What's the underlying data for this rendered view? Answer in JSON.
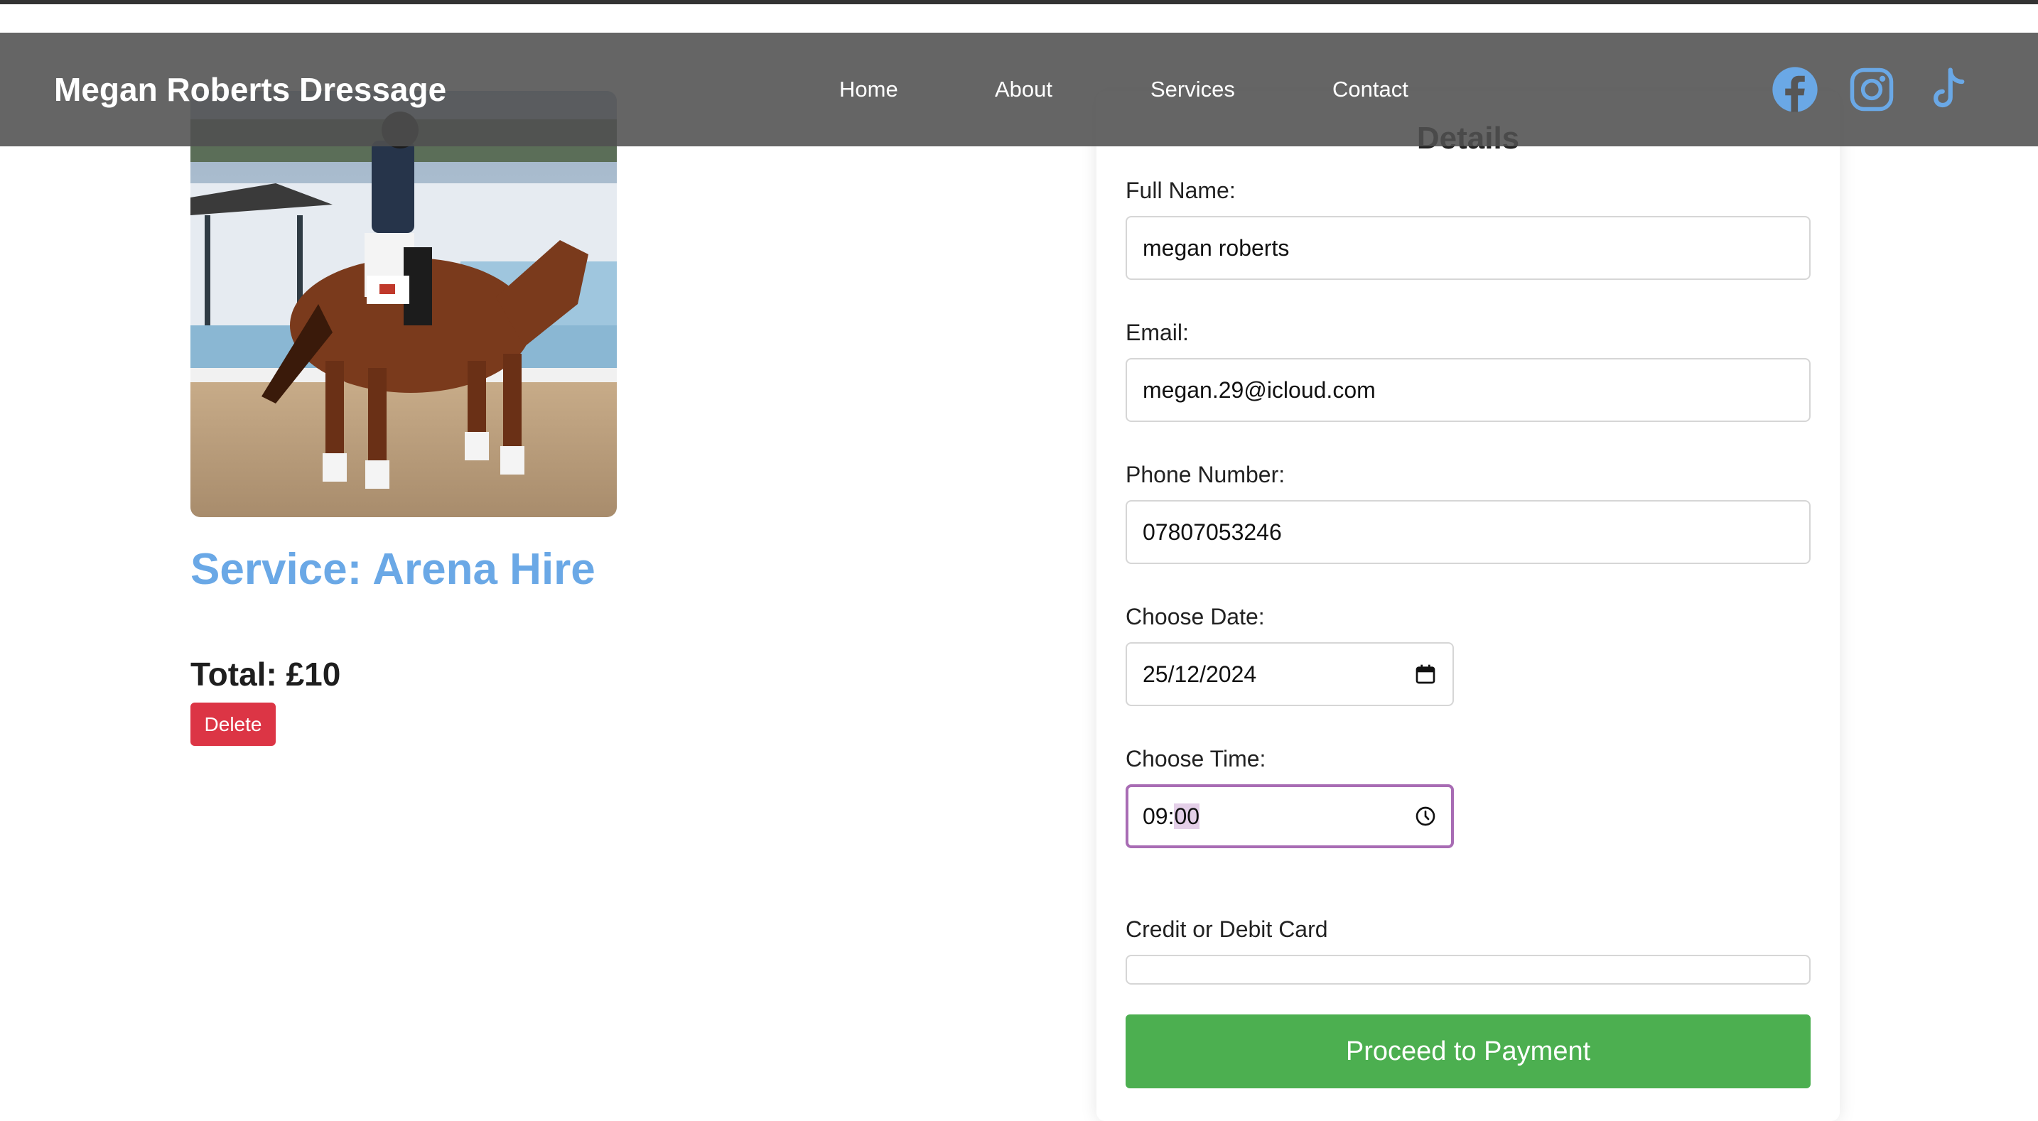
{
  "navbar": {
    "brand": "Megan Roberts Dressage",
    "links": [
      "Home",
      "About",
      "Services",
      "Contact"
    ],
    "social_icons": [
      "facebook-icon",
      "instagram-icon",
      "tiktok-icon"
    ],
    "icon_color": "#6aa8e6"
  },
  "service": {
    "title": "Service: Arena Hire",
    "total": "Total: £10",
    "delete_label": "Delete",
    "image": "horse-and-rider-dressage-photo"
  },
  "form": {
    "title": "Details",
    "full_name_label": "Full Name:",
    "full_name_value": "megan roberts",
    "email_label": "Email:",
    "email_value": "megan.29@icloud.com",
    "phone_label": "Phone Number:",
    "phone_value": "07807053246",
    "date_label": "Choose Date:",
    "date_value": "25/12/2024",
    "time_label": "Choose Time:",
    "time_hours": "09:",
    "time_minutes": "00",
    "card_label": "Credit or Debit Card",
    "pay_label": "Proceed to Payment"
  },
  "colors": {
    "accent_blue": "#6aa8e6",
    "delete_red": "#dc3545",
    "pay_green": "#4caf50",
    "focus_purple": "#a86cb4"
  }
}
